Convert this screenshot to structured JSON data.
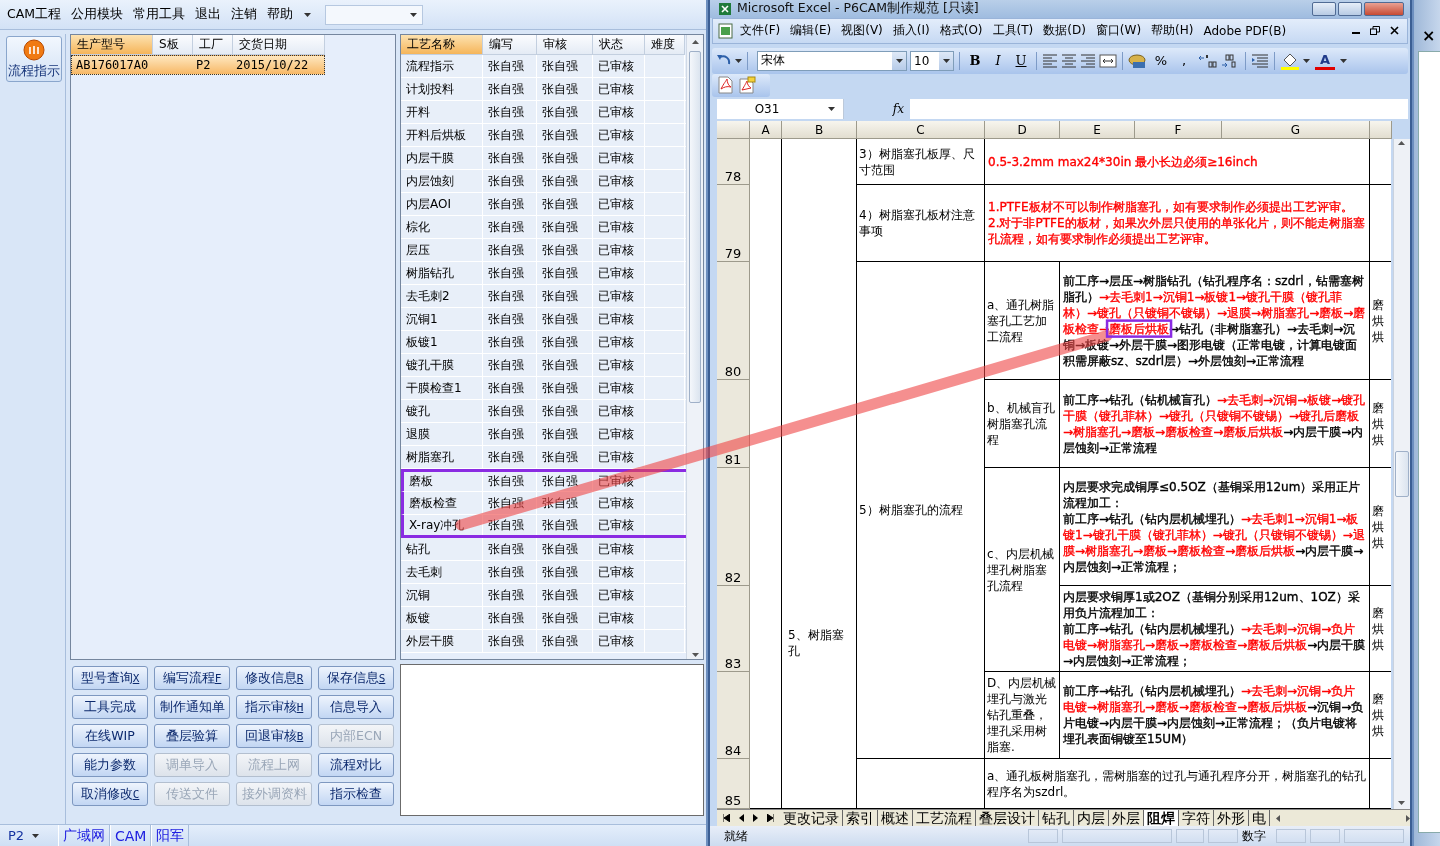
{
  "app": {
    "menu": [
      {
        "label": "CAM工程"
      },
      {
        "label": "公用模块"
      },
      {
        "label": "常用工具"
      },
      {
        "label": "退出"
      },
      {
        "label": "注销"
      },
      {
        "label": "帮助"
      }
    ],
    "sidebar": [
      {
        "label": "流程指示"
      }
    ],
    "orders": {
      "columns": [
        {
          "label": "生产型号",
          "selected": true
        },
        {
          "label": "S板",
          "selected": false
        },
        {
          "label": "工厂",
          "selected": false
        },
        {
          "label": "交货日期",
          "selected": false
        }
      ],
      "rows": [
        {
          "model": "AB176017A0",
          "factory": "P2",
          "date": "2015/10/22",
          "selected": true
        }
      ]
    },
    "processes": {
      "columns": [
        {
          "label": "工艺名称",
          "selected": true
        },
        {
          "label": "编写",
          "selected": false
        },
        {
          "label": "审核",
          "selected": false
        },
        {
          "label": "状态",
          "selected": false
        },
        {
          "label": "难度",
          "selected": false
        }
      ],
      "rows": [
        {
          "name": "流程指示",
          "writer": "张自强",
          "reviewer": "张自强",
          "status": "已审核",
          "boxed": false
        },
        {
          "name": "计划投料",
          "writer": "张自强",
          "reviewer": "张自强",
          "status": "已审核",
          "boxed": false
        },
        {
          "name": "开料",
          "writer": "张自强",
          "reviewer": "张自强",
          "status": "已审核",
          "boxed": false
        },
        {
          "name": "开料后烘板",
          "writer": "张自强",
          "reviewer": "张自强",
          "status": "已审核",
          "boxed": false
        },
        {
          "name": "内层干膜",
          "writer": "张自强",
          "reviewer": "张自强",
          "status": "已审核",
          "boxed": false
        },
        {
          "name": "内层蚀刻",
          "writer": "张自强",
          "reviewer": "张自强",
          "status": "已审核",
          "boxed": false
        },
        {
          "name": "内层AOI",
          "writer": "张自强",
          "reviewer": "张自强",
          "status": "已审核",
          "boxed": false
        },
        {
          "name": "棕化",
          "writer": "张自强",
          "reviewer": "张自强",
          "status": "已审核",
          "boxed": false
        },
        {
          "name": "层压",
          "writer": "张自强",
          "reviewer": "张自强",
          "status": "已审核",
          "boxed": false
        },
        {
          "name": "树脂钻孔",
          "writer": "张自强",
          "reviewer": "张自强",
          "status": "已审核",
          "boxed": false
        },
        {
          "name": "去毛刺2",
          "writer": "张自强",
          "reviewer": "张自强",
          "status": "已审核",
          "boxed": false
        },
        {
          "name": "沉铜1",
          "writer": "张自强",
          "reviewer": "张自强",
          "status": "已审核",
          "boxed": false
        },
        {
          "name": "板镀1",
          "writer": "张自强",
          "reviewer": "张自强",
          "status": "已审核",
          "boxed": false
        },
        {
          "name": "镀孔干膜",
          "writer": "张自强",
          "reviewer": "张自强",
          "status": "已审核",
          "boxed": false
        },
        {
          "name": "干膜检查1",
          "writer": "张自强",
          "reviewer": "张自强",
          "status": "已审核",
          "boxed": false
        },
        {
          "name": "镀孔",
          "writer": "张自强",
          "reviewer": "张自强",
          "status": "已审核",
          "boxed": false
        },
        {
          "name": "退膜",
          "writer": "张自强",
          "reviewer": "张自强",
          "status": "已审核",
          "boxed": false
        },
        {
          "name": "树脂塞孔",
          "writer": "张自强",
          "reviewer": "张自强",
          "status": "已审核",
          "boxed": false
        },
        {
          "name": "磨板",
          "writer": "张自强",
          "reviewer": "张自强",
          "status": "已审核",
          "boxed": true
        },
        {
          "name": "磨板检查",
          "writer": "张自强",
          "reviewer": "张自强",
          "status": "已审核",
          "boxed": true
        },
        {
          "name": "X-ray冲孔",
          "writer": "张自强",
          "reviewer": "张自强",
          "status": "已审核",
          "boxed": true
        },
        {
          "name": "钻孔",
          "writer": "张自强",
          "reviewer": "张自强",
          "status": "已审核",
          "boxed": false
        },
        {
          "name": "去毛刺",
          "writer": "张自强",
          "reviewer": "张自强",
          "status": "已审核",
          "boxed": false
        },
        {
          "name": "沉铜",
          "writer": "张自强",
          "reviewer": "张自强",
          "status": "已审核",
          "boxed": false
        },
        {
          "name": "板镀",
          "writer": "张自强",
          "reviewer": "张自强",
          "status": "已审核",
          "boxed": false
        },
        {
          "name": "外层干膜",
          "writer": "张自强",
          "reviewer": "张自强",
          "status": "已审核",
          "boxed": false
        }
      ]
    },
    "buttons": [
      {
        "label": "型号查询",
        "shortcut": "X",
        "disabled": false
      },
      {
        "label": "编写流程",
        "shortcut": "F",
        "disabled": false
      },
      {
        "label": "修改信息",
        "shortcut": "R",
        "disabled": false
      },
      {
        "label": "保存信息",
        "shortcut": "S",
        "disabled": false
      },
      {
        "label": "工具完成",
        "disabled": false
      },
      {
        "label": "制作通知单",
        "disabled": false
      },
      {
        "label": "指示审核",
        "shortcut": "H",
        "disabled": false
      },
      {
        "label": "信息导入",
        "disabled": false
      },
      {
        "label": "在线WIP",
        "disabled": false
      },
      {
        "label": "叠层验算",
        "disabled": false
      },
      {
        "label": "回退审核",
        "shortcut": "B",
        "disabled": false
      },
      {
        "label": "内部ECN",
        "disabled": true
      },
      {
        "label": "能力参数",
        "disabled": false
      },
      {
        "label": "调单导入",
        "disabled": true
      },
      {
        "label": "流程上网",
        "disabled": true
      },
      {
        "label": "流程对比",
        "disabled": false
      },
      {
        "label": "取消修改",
        "shortcut": "C",
        "disabled": false
      },
      {
        "label": "传送文件",
        "disabled": true
      },
      {
        "label": "接外调资料",
        "disabled": true
      },
      {
        "label": "指示检查",
        "disabled": false
      }
    ],
    "status_bar": {
      "site": "P2",
      "items": [
        {
          "label": "广域网"
        },
        {
          "label": "CAM"
        },
        {
          "label": "阳军"
        }
      ]
    }
  },
  "excel": {
    "title": "Microsoft Excel - P6CAM制作规范  [只读]",
    "menu": [
      {
        "label": "文件(F)"
      },
      {
        "label": "编辑(E)"
      },
      {
        "label": "视图(V)"
      },
      {
        "label": "插入(I)"
      },
      {
        "label": "格式(O)"
      },
      {
        "label": "工具(T)"
      },
      {
        "label": "数据(D)"
      },
      {
        "label": "窗口(W)"
      },
      {
        "label": "帮助(H)"
      },
      {
        "label": "Adobe PDF(B)"
      }
    ],
    "font": "宋体",
    "size": "10",
    "format_buttons": [
      {
        "kind": "bold",
        "label": "B"
      },
      {
        "kind": "italic",
        "label": "I"
      },
      {
        "kind": "underline",
        "label": "U"
      }
    ],
    "symbol_buttons": [
      {
        "label": "%"
      },
      {
        "label": ","
      }
    ],
    "font_color_label": "A",
    "name_box": "O31",
    "formula_label": "fx",
    "columns": [
      "A",
      "B",
      "C",
      "D",
      "E",
      "F",
      "G"
    ],
    "rows": [
      "78",
      "79",
      "80",
      "81",
      "82",
      "83",
      "84",
      "85"
    ],
    "cells": [
      {
        "kind": "text",
        "text": "5、树脂塞孔"
      },
      {
        "kind": "text",
        "text": "3）树脂塞孔板厚、尺寸范围"
      },
      {
        "kind": "rich",
        "paragraphs": [
          [
            {
              "text": "0.5-3.2mm    max24*30in 最小长边必须≥16inch",
              "color": "#ff0000"
            }
          ]
        ]
      },
      {
        "kind": "text",
        "text": "4）树脂塞孔板材注意事项"
      },
      {
        "kind": "rich",
        "paragraphs": [
          [
            {
              "text": "1.PTFE板材不可以制作树脂塞孔，如有要求制作必须提出工艺评审。",
              "color": "#ff0000"
            }
          ],
          [
            {
              "text": "2.对于非PTFE的板材，如果次外层只使用的单张化片，则不能走树脂塞孔流程，如有要求制作必须提出工艺评审。",
              "color": "#ff0000"
            }
          ]
        ]
      },
      {
        "kind": "text",
        "text": "5）树脂塞孔的流程"
      },
      {
        "kind": "text",
        "text": "a、通孔树脂塞孔工艺加工流程"
      },
      {
        "kind": "rich",
        "paragraphs": [
          [
            {
              "text": "前工序→层压→树脂钻孔（钻孔程序名：szdrl，钻需塞树脂孔）",
              "color": "#000000"
            },
            {
              "text": "→去毛刺1→沉铜1→板镀1→镀孔干膜（镀孔菲林）→镀孔（只镀铜不镀锡）→退膜→树脂塞孔→磨板→磨板检查→",
              "color": "#ff0000"
            },
            {
              "text": "磨板后烘板",
              "color": "#ff0000",
              "boxed": true
            },
            {
              "text": "→钻孔（非树脂塞孔）→去毛刺→沉铜→板镀→外层干膜→图形电镀（正常电镀，计算电镀面积需屏蔽sz、szdrl层）→外层蚀刻→正常流程",
              "color": "#000000"
            }
          ]
        ]
      },
      {
        "kind": "stack",
        "lines": [
          "磨",
          "烘",
          "烘"
        ]
      },
      {
        "kind": "text",
        "text": "b、机械盲孔树脂塞孔流程"
      },
      {
        "kind": "rich",
        "paragraphs": [
          [
            {
              "text": "前工序→钻孔（钻机械盲孔）",
              "color": "#000000"
            },
            {
              "text": "→去毛刺→沉铜→板镀→镀孔干膜（镀孔菲林）→镀孔（只镀铜不镀锡）→镀孔后磨板→树脂塞孔→磨板→磨板检查→磨板后烘板",
              "color": "#ff0000"
            },
            {
              "text": "→内层干膜→内层蚀刻→正常流程",
              "color": "#000000"
            }
          ]
        ]
      },
      {
        "kind": "stack",
        "lines": [
          "磨",
          "烘",
          "烘"
        ]
      },
      {
        "kind": "text",
        "text": "c、内层机械埋孔树脂塞孔流程"
      },
      {
        "kind": "rich",
        "paragraphs": [
          [
            {
              "text": "内层要求完成铜厚≤0.5OZ（基铜采用12um）采用正片流程加工：",
              "color": "#000000"
            }
          ],
          [
            {
              "text": "前工序→钻孔（钻内层机械埋孔）",
              "color": "#000000"
            },
            {
              "text": "→去毛刺1→沉铜1→板镀1→镀孔干膜（镀孔菲林）→镀孔（只镀铜不镀锡）→退膜→树脂塞孔→磨板→磨板检查→磨板后烘板",
              "color": "#ff0000"
            },
            {
              "text": "→内层干膜→内层蚀刻→正常流程；",
              "color": "#000000"
            }
          ]
        ]
      },
      {
        "kind": "stack",
        "lines": [
          "磨",
          "烘",
          "烘"
        ]
      },
      {
        "kind": "rich",
        "paragraphs": [
          [
            {
              "text": "内层要求铜厚1或2OZ（基铜分别采用12um、1OZ）采用负片流程加工：",
              "color": "#000000"
            }
          ],
          [
            {
              "text": "前工序→钻孔（钻内层机械埋孔）",
              "color": "#000000"
            },
            {
              "text": "→去毛刺→沉铜→负片电镀→树脂塞孔→磨板→磨板检查→磨板后烘板",
              "color": "#ff0000"
            },
            {
              "text": "→内层干膜→内层蚀刻→正常流程；",
              "color": "#000000"
            }
          ]
        ]
      },
      {
        "kind": "stack",
        "lines": [
          "磨",
          "烘",
          "烘"
        ]
      },
      {
        "kind": "text",
        "text": "D、内层机械埋孔与激光钻孔重叠，埋孔采用树脂塞."
      },
      {
        "kind": "rich",
        "paragraphs": [
          [
            {
              "text": "前工序→钻孔（钻内层机械埋孔）",
              "color": "#000000"
            },
            {
              "text": "→去毛刺→沉铜→负片电镀→树脂塞孔→磨板→磨板检查→磨板后烘板",
              "color": "#ff0000"
            },
            {
              "text": "→沉铜→负片电镀→内层干膜→内层蚀刻→正常流程；（负片电镀将埋孔表面铜镀至15UM）",
              "color": "#000000"
            }
          ]
        ]
      },
      {
        "kind": "stack",
        "lines": [
          "磨",
          "烘",
          "烘"
        ]
      },
      {
        "kind": "text",
        "text": "a、通孔板树脂塞孔，需树脂塞的过孔与通孔程序分开，树脂塞孔的钻孔程序名为szdrl。"
      }
    ],
    "sheets": [
      {
        "label": "更改记录",
        "selected": false
      },
      {
        "label": "索引",
        "selected": false
      },
      {
        "label": "概述",
        "selected": false
      },
      {
        "label": "工艺流程",
        "selected": false
      },
      {
        "label": "叠层设计",
        "selected": false
      },
      {
        "label": "钻孔",
        "selected": false
      },
      {
        "label": "内层",
        "selected": false
      },
      {
        "label": "外层",
        "selected": false
      },
      {
        "label": "阻焊",
        "selected": true
      },
      {
        "label": "字符",
        "selected": false
      },
      {
        "label": "外形",
        "selected": false
      },
      {
        "label": "电",
        "selected": false
      }
    ],
    "status": "就绪",
    "indicator": "数字"
  },
  "background_window": {
    "close": "×"
  }
}
